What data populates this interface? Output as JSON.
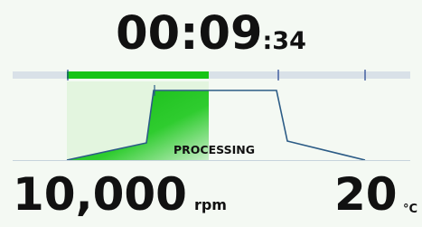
{
  "timer": {
    "main": "00:09",
    "seconds": ":34"
  },
  "status": {
    "label": "PROCESSING"
  },
  "speed": {
    "value": "10,000",
    "unit": "rpm"
  },
  "temperature": {
    "value": "20",
    "unit": "°C"
  },
  "colors": {
    "accent_green": "#16c416",
    "profile_line": "#2c5c86",
    "track": "#d9e1e8",
    "tick": "#1f3f8f",
    "background": "#f4f9f3"
  },
  "progress": {
    "segments_total": 4,
    "segments_completed": 2
  }
}
